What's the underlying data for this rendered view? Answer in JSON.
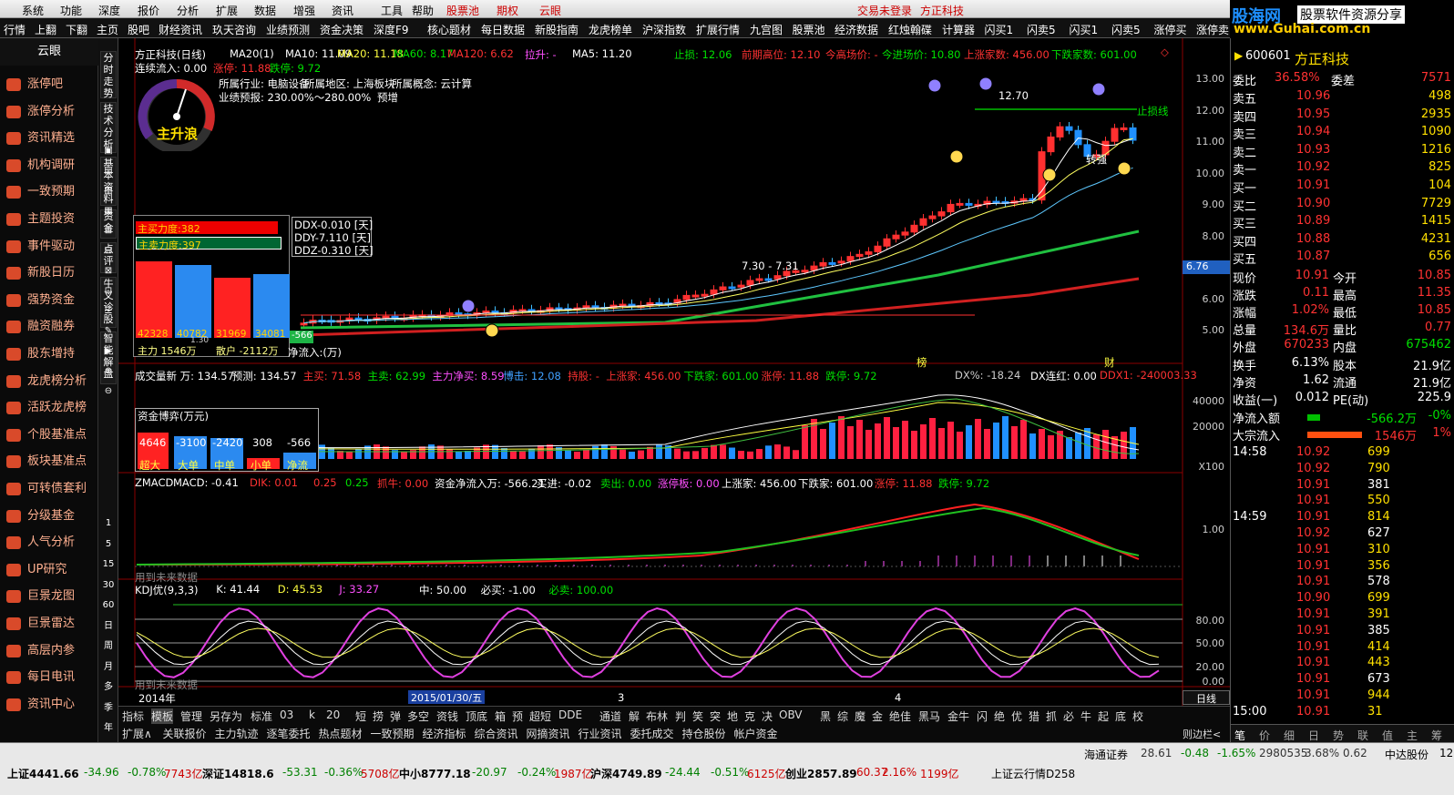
{
  "menu": {
    "items": [
      "系统",
      "功能",
      "深度",
      "报价",
      "分析",
      "扩展",
      "数据",
      "增强",
      "资讯",
      "工具",
      "帮助"
    ],
    "highlights": [
      "股票池",
      "期权",
      "云眼"
    ],
    "right": [
      "交易未登录",
      "方正科技"
    ]
  },
  "logo": {
    "title": "股海网",
    "subtitle": "股票软件资源分享",
    "url": "www.Guhai.com.cn"
  },
  "toolbar": [
    "行情",
    "上翻",
    "下翻",
    "主页",
    "股吧",
    "财经资讯",
    "玖天咨询",
    "业绩预测",
    "资金决策",
    "深度F9",
    "核心题材",
    "每日数据",
    "新股指南",
    "龙虎榜单",
    "沪深指数",
    "扩展行情",
    "九宫图",
    "股票池",
    "经济数据",
    "红烛翰碟",
    "计算器",
    "闪买1",
    "闪卖5",
    "闪买1",
    "闪卖5",
    "涨停买",
    "涨停卖"
  ],
  "leftnav": {
    "header": "云眼",
    "items": [
      "涨停吧",
      "涨停分析",
      "资讯精选",
      "机构调研",
      "一致预期",
      "主题投资",
      "事件驱动",
      "新股日历",
      "强势资金",
      "融资融券",
      "股东增持",
      "龙虎榜分析",
      "活跃龙虎榜",
      "个股基准点",
      "板块基准点",
      "可转债套利",
      "分级基金",
      "人气分析",
      "UP研究",
      "巨景龙图",
      "巨景雷达",
      "高层内参",
      "每日电讯",
      "资讯中心"
    ]
  },
  "vtabs": [
    "分时走势",
    "技术分析",
    "基本资料",
    "资金",
    "点评",
    "牛叉诊股",
    "智能解盘"
  ],
  "periods": [
    "1",
    "5",
    "15",
    "30",
    "60",
    "日",
    "周",
    "月",
    "多",
    "季",
    "年"
  ],
  "main": {
    "header": {
      "name": "方正科技(日线)",
      "ma_items": [
        "MA20(1)",
        "MA10: 11.09",
        "MA20: 11.18",
        "MA60: 8.17",
        "MA120: 6.62",
        "拉升: -",
        "MA5: 11.20"
      ],
      "flow": "连续流入: 0.00",
      "zhangting": "涨停: 11.88",
      "dieting": "跌停: 9.72",
      "right": [
        "止损: 12.06",
        "前期高位: 12.10",
        "今高场价: -",
        "今进场价: 10.80",
        "上涨家数: 456.00",
        "下跌家数: 601.00"
      ]
    },
    "gauge_label": "主升浪",
    "info": [
      "所属行业: 电脑设备",
      "所属地区: 上海板块",
      "所属概念: 云计算",
      "业绩预报: 230.00%～280.00%",
      "预增"
    ],
    "axis": [
      "13.00",
      "12.00",
      "11.00",
      "10.00",
      "9.00",
      "8.00",
      "7.00",
      "6.00",
      "5.00"
    ],
    "price_tag": "6.76",
    "annot": {
      "high": "12.70",
      "stop": "止损线",
      "turn": "转强",
      "range": "7.30 - 7.31"
    },
    "forces": {
      "buy": "主买力度:382",
      "sell": "主卖力度:397",
      "ddx": "DDX-0.010 [天]",
      "ddy": "DDY-7.110 [天]",
      "ddz": "DDZ-0.310 [天]",
      "bars": [
        "42328",
        "40782",
        "31969",
        "34081"
      ],
      "main": "主力 1546万",
      "retail": "散户 -2112万",
      "net": "净流入:(万)",
      "val": "-566",
      "mini": "1.30"
    },
    "markers": [
      "榜",
      "财"
    ]
  },
  "vol": {
    "header": [
      "成交量新 万: 134.57",
      "预测: 134.57",
      "主买: 71.58",
      "主卖: 62.99",
      "主力净买: 8.59",
      "博击: 12.08",
      "持股: -",
      "上涨家: 456.00",
      "下跌家: 601.00",
      "涨停: 11.88",
      "跌停: 9.72"
    ],
    "right": [
      "DX%: -18.24",
      "DX连红: 0.00",
      "DDX1: -240003.33"
    ],
    "axis": [
      "40000",
      "20000",
      "X100"
    ],
    "box": {
      "title": "资金博弈(万元)",
      "vals": [
        "4646",
        "-3100",
        "-2420",
        "308",
        "-566"
      ],
      "labels": [
        "超大",
        "大单",
        "中单",
        "小单",
        "净流"
      ]
    }
  },
  "macd": {
    "header": [
      "ZMACD",
      "MACD: -0.41",
      "DIK: 0.01",
      "0.25",
      "0.25",
      "抓牛: 0.00",
      "资金净流入万: -566.21",
      "买进: -0.02",
      "卖出: 0.00",
      "涨停板: 0.00",
      "上涨家: 456.00",
      "下跌家: 601.00",
      "涨停: 11.88",
      "跌停: 9.72"
    ],
    "axis": [
      "1.00"
    ],
    "foot": "用到未来数据"
  },
  "kdj": {
    "header": [
      "KDJ优(9,3,3)",
      "K: 41.44",
      "D: 45.53",
      "J: 33.27",
      "中: 50.00",
      "必买: -1.00",
      "必卖: 100.00"
    ],
    "axis": [
      "80.00",
      "50.00",
      "20.00",
      "0.00"
    ],
    "foot": "用到未来数据"
  },
  "dates": {
    "d1": "2014年",
    "d2": "2015/01/30/五",
    "d3": "3",
    "d4": "4",
    "unit": "日线"
  },
  "bottomtabs1": [
    "指标",
    "模板",
    "管理",
    "另存为",
    "标准",
    "03",
    "k",
    "20",
    "短",
    "捞",
    "弹",
    "多空",
    "资钱",
    "顶底",
    "箱",
    "预",
    "超短",
    "DDE",
    "通道",
    "解",
    "布林",
    "判",
    "笑",
    "突",
    "地",
    "克",
    "决",
    "OBV",
    "黑",
    "综",
    "魔",
    "金",
    "绝佳",
    "黑马",
    "金牛",
    "闪",
    "绝",
    "优",
    "猎",
    "抓",
    "必",
    "牛",
    "起",
    "底",
    "校"
  ],
  "bottomtabs2": [
    "扩展∧",
    "关联报价",
    "主力轨迹",
    "逐笔委托",
    "热点题材",
    "一致预期",
    "经济指标",
    "综合资讯",
    "网摘资讯",
    "行业资讯",
    "委托成交",
    "持仓股份",
    "帐户资金"
  ],
  "bottomright": "则边栏<",
  "quote": {
    "code": "600601",
    "name": "方正科技",
    "weibi": {
      "label": "委比",
      "val": "36.58%",
      "label2": "委差",
      "val2": "7571"
    },
    "sells": [
      {
        "l": "卖五",
        "p": "10.96",
        "v": "498"
      },
      {
        "l": "卖四",
        "p": "10.95",
        "v": "2935"
      },
      {
        "l": "卖三",
        "p": "10.94",
        "v": "1090"
      },
      {
        "l": "卖二",
        "p": "10.93",
        "v": "1216"
      },
      {
        "l": "卖一",
        "p": "10.92",
        "v": "825"
      }
    ],
    "buys": [
      {
        "l": "买一",
        "p": "10.91",
        "v": "104"
      },
      {
        "l": "买二",
        "p": "10.90",
        "v": "7729"
      },
      {
        "l": "买三",
        "p": "10.89",
        "v": "1415"
      },
      {
        "l": "买四",
        "p": "10.88",
        "v": "4231"
      },
      {
        "l": "买五",
        "p": "10.87",
        "v": "656"
      }
    ],
    "stats": [
      [
        "现价",
        "10.91",
        "今开",
        "10.85"
      ],
      [
        "涨跌",
        "0.11",
        "最高",
        "11.35"
      ],
      [
        "涨幅",
        "1.02%",
        "最低",
        "10.85"
      ],
      [
        "总量",
        "134.6万",
        "量比",
        "0.77"
      ],
      [
        "外盘",
        "670233",
        "内盘",
        "675462"
      ]
    ],
    "stats2": [
      [
        "换手",
        "6.13%",
        "股本",
        "21.9亿"
      ],
      [
        "净资",
        "1.62",
        "流通",
        "21.9亿"
      ],
      [
        "收益(一)",
        "0.012",
        "PE(动)",
        "225.9"
      ]
    ],
    "flows": [
      [
        "净流入额",
        "-566.2万",
        "-0%"
      ],
      [
        "大宗流入",
        "1546万",
        "1%"
      ]
    ],
    "ticks": [
      [
        "14:58",
        "10.92",
        "699"
      ],
      [
        "",
        "10.92",
        "790"
      ],
      [
        "",
        "10.91",
        "381"
      ],
      [
        "",
        "10.91",
        "550"
      ],
      [
        "14:59",
        "10.91",
        "814"
      ],
      [
        "",
        "10.92",
        "627"
      ],
      [
        "",
        "10.91",
        "310"
      ],
      [
        "",
        "10.91",
        "356"
      ],
      [
        "",
        "10.91",
        "578"
      ],
      [
        "",
        "10.90",
        "699"
      ],
      [
        "",
        "10.91",
        "391"
      ],
      [
        "",
        "10.91",
        "385"
      ],
      [
        "",
        "10.91",
        "414"
      ],
      [
        "",
        "10.91",
        "443"
      ],
      [
        "",
        "10.91",
        "673"
      ],
      [
        "",
        "10.91",
        "944"
      ],
      [
        "15:00",
        "10.91",
        "31"
      ]
    ],
    "tabs": [
      "笔",
      "价",
      "细",
      "日",
      "势",
      "联",
      "值",
      "主",
      "筹"
    ]
  },
  "status": {
    "items": [
      "上证4441.66",
      "-34.96",
      "-0.78%",
      "7743亿",
      "深证14818.6",
      "-53.31",
      "-0.36%",
      "5708亿",
      "中小8777.18",
      "-20.97",
      "-0.24%",
      "1987亿",
      "沪深4749.89",
      "-24.44",
      "-0.51%",
      "6125亿",
      "创业2857.89",
      "60.37",
      "2.16%",
      "1199亿"
    ],
    "broker": "海通证券",
    "broker_vals": [
      "28.61",
      "-0.48",
      "-1.65%",
      "2980535",
      "3.68%",
      "0.62"
    ],
    "app": "中达股份",
    "app_val": "12.",
    "cloud": "上证云行情D258"
  }
}
